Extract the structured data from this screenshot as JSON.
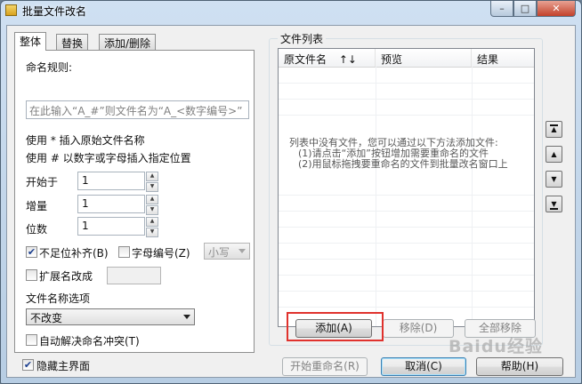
{
  "window": {
    "title": "批量文件改名",
    "controls": {
      "minimize": "–",
      "maximize": "□",
      "close": "✕"
    }
  },
  "tabs": [
    {
      "label": "整体",
      "active": true
    },
    {
      "label": "替换",
      "active": false
    },
    {
      "label": "添加/删除",
      "active": false
    }
  ],
  "left": {
    "rule_label": "命名规则:",
    "rule_hint": "在此输入“A_#”则文件名为“A_<数字编号>”",
    "tip1": "使用 * 插入原始文件名称",
    "tip2": "使用 # 以数字或字母插入指定位置",
    "start_label": "开始于",
    "start_value": "1",
    "step_label": "增量",
    "step_value": "1",
    "digits_label": "位数",
    "digits_value": "1",
    "pad_label": "不足位补齐(B)",
    "pad_checked": true,
    "letter_label": "字母编号(Z)",
    "letter_checked": false,
    "case_value": "小写",
    "ext_label": "扩展名改成",
    "ext_checked": false,
    "name_opt_label": "文件名称选项",
    "name_opt_value": "不改变",
    "autoresolve_label": "自动解决命名冲突(T)",
    "autoresolve_checked": false
  },
  "filelist": {
    "group_title": "文件列表",
    "columns": [
      {
        "label": "原文件名",
        "sort_icon": "↑↓"
      },
      {
        "label": "预览"
      },
      {
        "label": "结果"
      }
    ],
    "empty_line1": "列表中没有文件，您可以通过以下方法添加文件:",
    "empty_line2": "(1)请点击“添加”按钮增加需要重命名的文件",
    "empty_line3": "(2)用鼠标拖拽要重命名的文件到批量改名窗口上",
    "add_button": "添加(A)",
    "remove_button": "移除(D)",
    "remove_all_button": "全部移除"
  },
  "side_buttons": {
    "top": "move-to-top",
    "up": "move-up",
    "down": "move-down",
    "bottom": "move-to-bottom"
  },
  "footer": {
    "hide_label": "隐藏主界面",
    "hide_checked": true,
    "start_button": "开始重命名(R)",
    "cancel_button": "取消(C)",
    "help_button": "帮助(H)"
  },
  "watermark": "Baidu经验",
  "colors": {
    "highlight_box": "#e0322d"
  }
}
